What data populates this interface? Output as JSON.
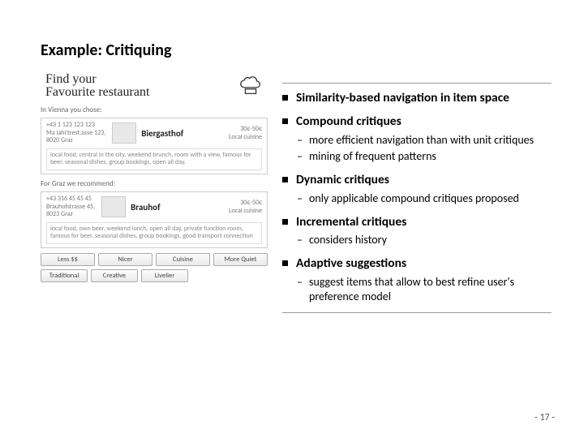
{
  "title": "Example: Critiquing",
  "page_number": "- 17 -",
  "left": {
    "slogan_line1": "Find your",
    "slogan_line2": "Favourite restaurant",
    "vienna_label": "In Vienna you chose:",
    "vienna": {
      "name": "Biergasthof",
      "phone": "+43 1 123 123 123",
      "addr1": "Ma iahi'trest:asse 123,",
      "addr2": "8020 Graz",
      "price": "30€-50€",
      "cuisine": "Local cuisine",
      "desc": "local food, central in the city, weekend brunch, room with a view, famous for beer, seasonal dishes, group bookings, open all day."
    },
    "graz_label": "For Graz we recommend:",
    "graz": {
      "name": "Brauhof",
      "phone": "+43 316 45 45 45",
      "addr1": "Brauhofstrasse 45,",
      "addr2": "8023 Graz",
      "price": "30€-50€",
      "cuisine": "Local cuisine",
      "desc": "local food, own beer, weekend lunch, open all day, private function room, famous for beer, seasonal dishes, group bookings, good transport connection"
    },
    "buttons_row1": [
      "Less $$",
      "Nicer",
      "Cuisine",
      "More Quiet"
    ],
    "buttons_row2": [
      "Traditional",
      "Creative",
      "Livelier"
    ]
  },
  "bullets": [
    {
      "head": "Similarity-based navigation in item space",
      "subs": []
    },
    {
      "head": "Compound critiques",
      "subs": [
        "more efficient navigation than with unit critiques",
        "mining of frequent patterns"
      ]
    },
    {
      "head": "Dynamic critiques",
      "subs": [
        "only applicable compound critiques proposed"
      ]
    },
    {
      "head": "Incremental critiques",
      "subs": [
        "considers history"
      ]
    },
    {
      "head": "Adaptive suggestions",
      "subs": [
        "suggest items that allow to best refine user's preference model"
      ]
    }
  ]
}
